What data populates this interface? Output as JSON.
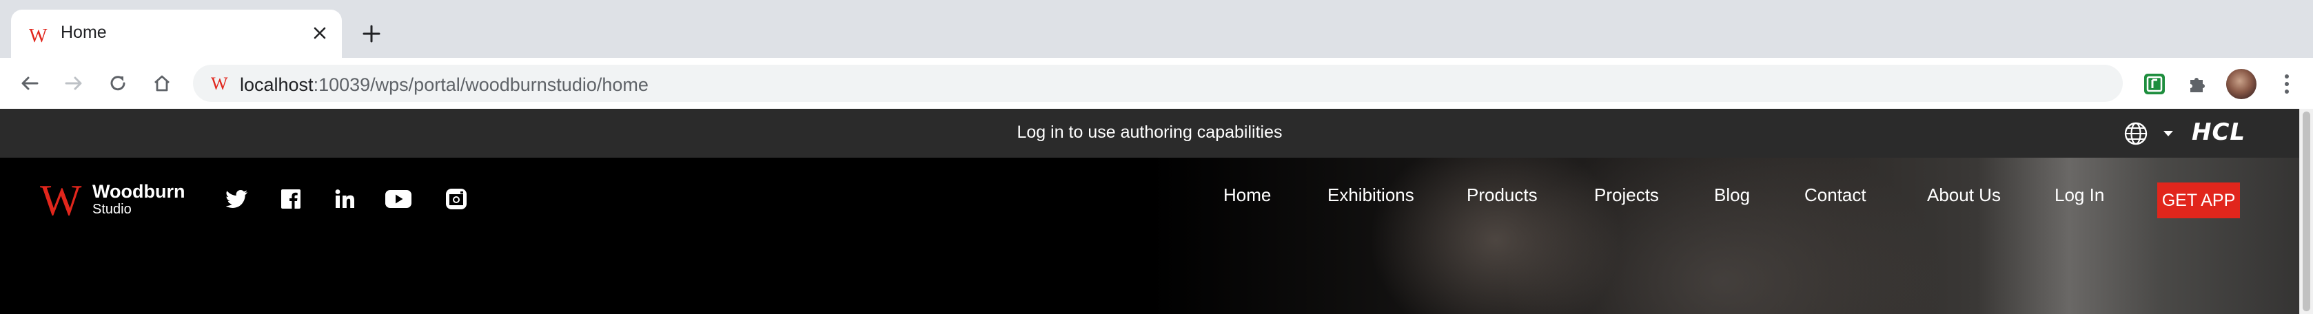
{
  "tab": {
    "title": "Home",
    "favicon": "woodburn-w-icon",
    "close_icon": "close-icon",
    "new_tab_icon": "plus-icon"
  },
  "toolbar": {
    "url_host": "localhost",
    "url_rest": ":10039/wps/portal/woodburnstudio/home",
    "back_icon": "back-arrow-icon",
    "forward_icon": "forward-arrow-icon",
    "reload_icon": "reload-icon",
    "home_icon": "home-icon",
    "extensions": [
      "green-extension-icon",
      "puzzle-extensions-icon"
    ],
    "avatar": "profile-avatar",
    "menu_icon": "kebab-menu-icon"
  },
  "authbar": {
    "message": "Log in to use authoring capabilities",
    "language_icon": "globe-icon",
    "dropdown_icon": "caret-down-icon",
    "brand": "HCL"
  },
  "site": {
    "logo_letter": "W",
    "brand_name": "Woodburn",
    "brand_sub": "Studio",
    "social": [
      "twitter-icon",
      "facebook-icon",
      "linkedin-icon",
      "youtube-icon",
      "instagram-icon"
    ],
    "nav": [
      "Home",
      "Exhibitions",
      "Products",
      "Projects",
      "Blog",
      "Contact",
      "About Us",
      "Log In"
    ],
    "cta": "GET APP"
  },
  "colors": {
    "accent_red": "#e1261c",
    "authbar_bg": "#2b2b2b",
    "tabstrip_bg": "#dee1e6"
  }
}
